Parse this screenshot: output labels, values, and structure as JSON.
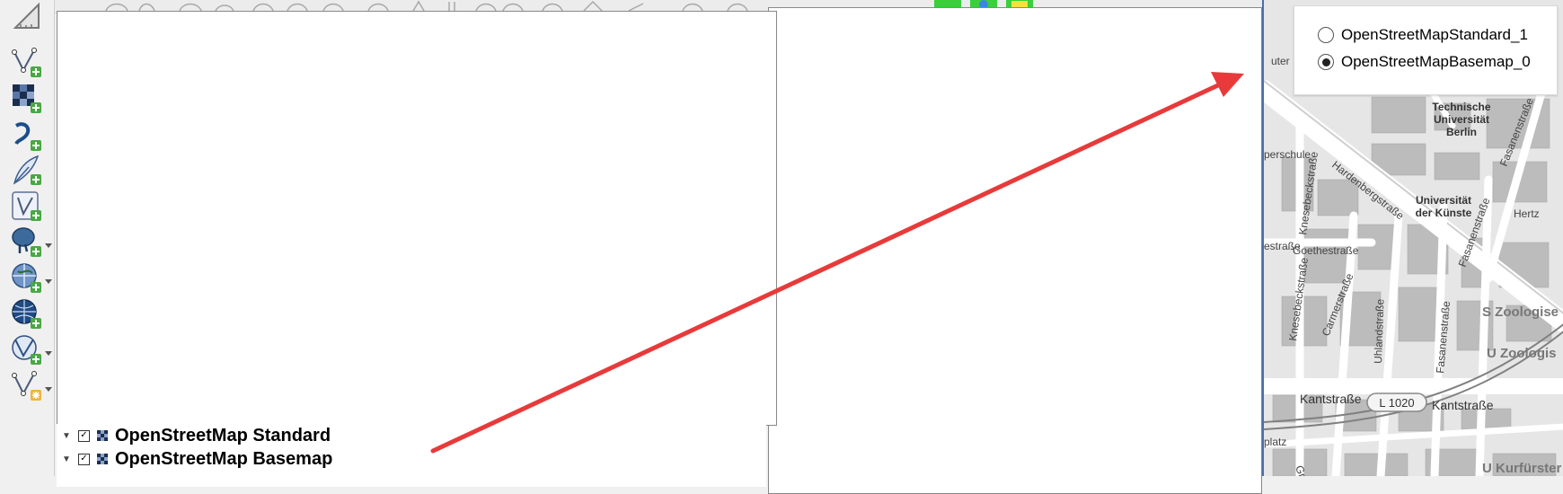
{
  "layers_panel": {
    "items": [
      {
        "label": "OpenStreetMap Standard",
        "checked": true
      },
      {
        "label": "OpenStreetMap Basemap",
        "checked": true
      }
    ]
  },
  "legend": {
    "options": [
      {
        "label": "OpenStreetMapStandard_1",
        "selected": false
      },
      {
        "label": "OpenStreetMapBasemap_0",
        "selected": true
      }
    ]
  },
  "map": {
    "labels": {
      "tu": "Technische\nUniversität\nBerlin",
      "tu_l1": "Technische",
      "tu_l2": "Universität",
      "tu_l3": "Berlin",
      "udk_l1": "Universität",
      "udk_l2": "der Künste",
      "hardenberg": "Hardenbergstraße",
      "fasanen1": "Fasanenstraße",
      "fasanen2": "Fasanenstraße",
      "fasanen3": "Fasanenstraße",
      "knesebeck1": "Knesebeckstraße",
      "knesebeck2": "Knesebeckstraße",
      "goethe": "Goethestraße",
      "estrasse": "estraße",
      "carmer": "Carmerstraße",
      "uhland": "Uhlandstraße",
      "kant1": "Kantstraße",
      "kant2": "Kantstraße",
      "l1020": "L 1020",
      "s_zoo": "S Zoologise",
      "u_zoo": "U Zoologis",
      "u_kurf": "U Kurfürster",
      "hertz": "Hertz",
      "uter": "uter",
      "perschule": "perschule",
      "platz": "platz",
      "grolm": "Grolm"
    },
    "colors": {
      "background": "#e8e8e8",
      "road": "#ffffff",
      "building": "#bdbdbd",
      "arrow": "#e83a3a"
    }
  },
  "icons": {
    "measure": "measure-icon",
    "new_vector": "new-vector-layer-icon",
    "raster": "raster-layer-icon",
    "spatialite": "spatialite-icon",
    "feather": "digitize-icon",
    "shapefile": "shapefile-icon",
    "postgis": "postgis-icon",
    "wms": "wms-icon",
    "wcs": "wcs-icon",
    "wfs": "wfs-icon",
    "virtual": "virtual-layer-icon"
  }
}
